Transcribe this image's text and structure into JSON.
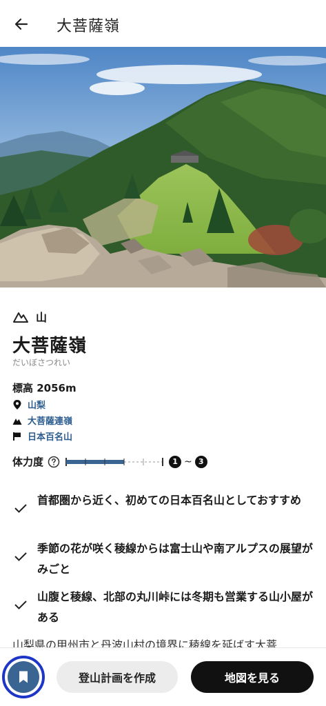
{
  "header": {
    "title": "大菩薩嶺"
  },
  "mountain": {
    "category_label": "山",
    "name": "大菩薩嶺",
    "reading": "だいぼさつれい",
    "elevation": "標高 2056m",
    "prefecture": "山梨",
    "range": "大菩薩連嶺",
    "list": "日本百名山"
  },
  "stamina": {
    "label": "体力度",
    "level": 0.6,
    "range_min": "1",
    "range_sep": "~",
    "range_max": "3"
  },
  "features": [
    {
      "text": "首都圏から近く、初めての日本百名山としておすすめ"
    },
    {
      "text": "季節の花が咲く稜線からは富士山や南アルプスの展望がみごと"
    },
    {
      "text": "山腹と稜線、北部の丸川峠には冬期も営業する山小屋がある"
    }
  ],
  "description": "山梨県の甲州市と丹波山村の境界に稜線を延ばす大菩",
  "actions": {
    "plan_label": "登山計画を作成",
    "map_label": "地図を見る"
  },
  "colors": {
    "accent": "#3a6592",
    "link": "#2d5d8f",
    "focus_ring": "#1d36c7"
  },
  "icons": [
    "back-arrow-icon",
    "mountain-icon",
    "location-pin-icon",
    "range-icon",
    "flag-icon",
    "help-icon",
    "check-icon",
    "bookmark-icon"
  ]
}
